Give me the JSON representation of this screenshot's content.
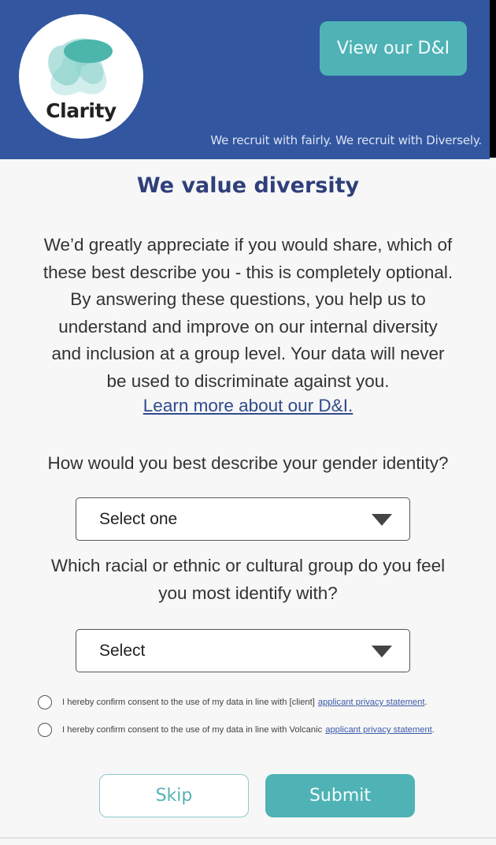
{
  "header": {
    "logo_text": "Clarity",
    "dni_button_label": "View our D&I",
    "tagline": "We recruit with fairly. We recruit with Diversely."
  },
  "main": {
    "title": "We value diversity",
    "intro_lines": [
      "We’d greatly appreciate if you would share, which of",
      "these best describe you - this is completely optional.",
      "By answering these questions, you help us to",
      "understand and improve on our internal diversity",
      "and inclusion at a group level. Your data will never",
      "be used to discriminate against you."
    ],
    "learn_more_link": "Learn more about our D&I.",
    "questions": [
      {
        "lines": [
          "How would you best describe your gender identity?"
        ],
        "select_value": "Select one"
      },
      {
        "lines": [
          "Which racial or ethnic or cultural group do you feel",
          "you most identify with?"
        ],
        "select_value": "Select"
      }
    ],
    "consents": [
      {
        "text": "I hereby confirm consent to the use of my data in line with [client]",
        "link": "applicant privacy statement",
        "checked": false
      },
      {
        "text": "I hereby confirm consent to the use of my data in line with Volcanic",
        "link": "applicant privacy statement",
        "checked": false
      }
    ]
  },
  "actions": {
    "skip_label": "Skip",
    "submit_label": "Submit"
  },
  "colors": {
    "header_bg": "#3257a0",
    "accent_teal": "#4fb3b6",
    "title_navy": "#2f3f7a",
    "link_blue": "#2f4a8e"
  }
}
